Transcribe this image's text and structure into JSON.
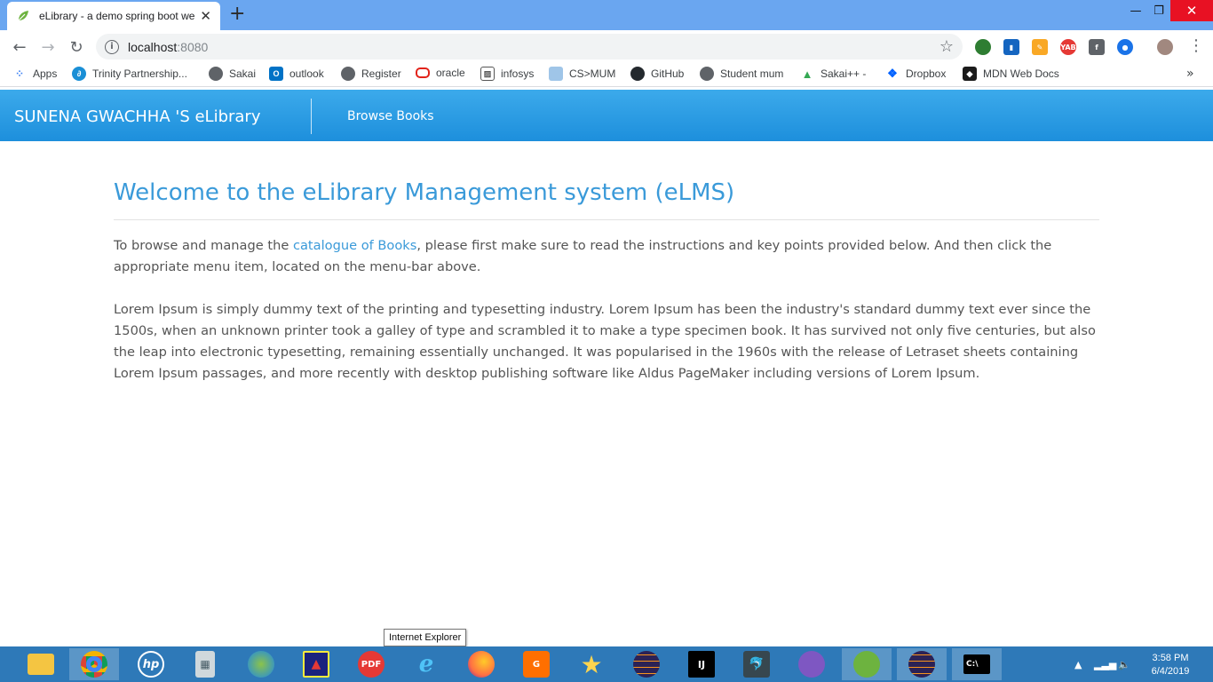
{
  "browser": {
    "tab_title": "eLibrary - a demo spring boot we",
    "url_host": "localhost",
    "url_port": ":8080",
    "bookmarks": [
      {
        "label": "Apps",
        "icon": "apps-grid-icon",
        "color": "#4285f4"
      },
      {
        "label": "Trinity Partnership...",
        "icon": "trinity-icon",
        "color": "#1a8fd6"
      },
      {
        "label": "Sakai",
        "icon": "globe-icon",
        "color": "#5f6368"
      },
      {
        "label": "outlook",
        "icon": "outlook-icon",
        "color": "#0072c6"
      },
      {
        "label": "Register",
        "icon": "globe-icon",
        "color": "#5f6368"
      },
      {
        "label": "oracle",
        "icon": "oracle-icon",
        "color": "#e2231a"
      },
      {
        "label": "infosys",
        "icon": "image-icon",
        "color": "#7a7a7a"
      },
      {
        "label": "CS>MUM",
        "icon": "page-icon",
        "color": "#9fc5e8"
      },
      {
        "label": "GitHub",
        "icon": "github-icon",
        "color": "#24292e"
      },
      {
        "label": "Student mum",
        "icon": "globe-icon",
        "color": "#5f6368"
      },
      {
        "label": "Sakai++ -",
        "icon": "google-drive-icon",
        "color": "#34a853"
      },
      {
        "label": "Dropbox",
        "icon": "dropbox-icon",
        "color": "#0061ff"
      },
      {
        "label": "MDN Web Docs",
        "icon": "mdn-icon",
        "color": "#1b1b1b"
      }
    ],
    "bookmarks_more": "»"
  },
  "app": {
    "brand": "SUNENA GWACHHA 'S eLibrary",
    "nav_browse": "Browse Books",
    "title": "Welcome to the eLibrary Management system (eLMS)",
    "intro_before": "To browse and manage the ",
    "intro_link": "catalogue of Books",
    "intro_after": ", please first make sure to read the instructions and key points provided below. And then click the appropriate menu item, located on the menu-bar above.",
    "lorem": "Lorem Ipsum is simply dummy text of the printing and typesetting industry. Lorem Ipsum has been the industry's standard dummy text ever since the 1500s, when an unknown printer took a galley of type and scrambled it to make a type specimen book. It has survived not only five centuries, but also the leap into electronic typesetting, remaining essentially unchanged. It was popularised in the 1960s with the release of Letraset sheets containing Lorem Ipsum passages, and more recently with desktop publishing software like Aldus PageMaker including versions of Lorem Ipsum.",
    "accent_color": "#3a9ad9",
    "navbar_color": "#2a9de4"
  },
  "taskbar": {
    "tooltip": "Internet Explorer",
    "time": "3:58 PM",
    "date": "6/4/2019",
    "apps": [
      "file-explorer-icon",
      "chrome-icon",
      "hp-icon",
      "calculator-icon",
      "globe-icon",
      "nepal-flag-icon",
      "pdf-icon",
      "internet-explorer-icon",
      "firefox-icon",
      "foxit-icon",
      "star-app-icon",
      "eclipse-icon",
      "intellij-icon",
      "mysql-icon",
      "github-desktop-icon",
      "spring-tool-icon",
      "eclipse-icon",
      "cmd-icon"
    ]
  }
}
